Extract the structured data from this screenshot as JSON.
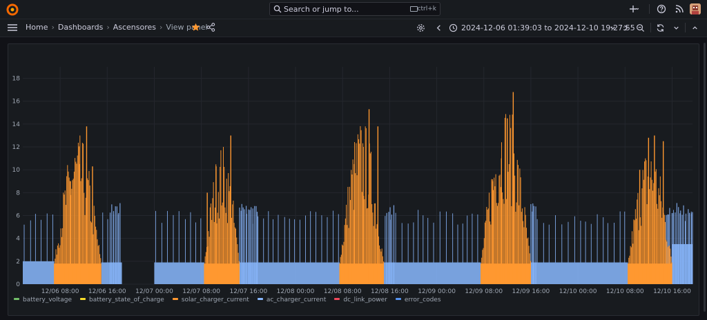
{
  "topbar": {
    "search_placeholder": "Search or jump to...",
    "search_shortcut": "ctrl+k"
  },
  "breadcrumb": {
    "items": [
      "Home",
      "Dashboards",
      "Ascensores"
    ],
    "current": "View panel"
  },
  "time_range": {
    "label": "2024-12-06 01:39:03 to 2024-12-10 19:27:55"
  },
  "colors": {
    "background": "#111217",
    "panel": "#181b1f",
    "brand_orange": "#f46800",
    "star": "#ff9830"
  },
  "chart_data": {
    "type": "area",
    "ylim": [
      0,
      19
    ],
    "xlim": [
      "2024-12-06 01:39",
      "2024-12-10 19:28"
    ],
    "y_ticks": [
      "0",
      "2",
      "4",
      "6",
      "8",
      "10",
      "12",
      "14",
      "16",
      "18"
    ],
    "x_ticks": [
      "12/06 08:00",
      "12/06 16:00",
      "12/07 00:00",
      "12/07 08:00",
      "12/07 16:00",
      "12/08 00:00",
      "12/08 08:00",
      "12/08 16:00",
      "12/09 00:00",
      "12/09 08:00",
      "12/09 16:00",
      "12/10 00:00",
      "12/10 08:00",
      "12/10 16:00"
    ],
    "grid": true,
    "legend_position": "bottom",
    "series": [
      {
        "name": "battery_voltage",
        "color": "#73bf69"
      },
      {
        "name": "battery_state_of_charge",
        "color": "#fade2a"
      },
      {
        "name": "solar_charger_current",
        "color": "#ff9830",
        "peaks": [
          {
            "x": "2024-12-06 09:45",
            "y": 9.0
          },
          {
            "x": "2024-12-06 11:15",
            "y": 10.5
          },
          {
            "x": "2024-12-06 12:30",
            "y": 13.8
          },
          {
            "x": "2024-12-06 13:30",
            "y": 10.3
          },
          {
            "x": "2024-12-07 09:00",
            "y": 8.0
          },
          {
            "x": "2024-12-07 10:30",
            "y": 10.3
          },
          {
            "x": "2024-12-07 13:00",
            "y": 13.0
          },
          {
            "x": "2024-12-08 10:00",
            "y": 10.5
          },
          {
            "x": "2024-12-08 11:30",
            "y": 12.0
          },
          {
            "x": "2024-12-08 12:30",
            "y": 15.3
          },
          {
            "x": "2024-12-08 14:00",
            "y": 13.8
          },
          {
            "x": "2024-12-09 09:30",
            "y": 9.0
          },
          {
            "x": "2024-12-09 11:00",
            "y": 11.0
          },
          {
            "x": "2024-12-09 12:00",
            "y": 14.5
          },
          {
            "x": "2024-12-09 13:00",
            "y": 16.8
          },
          {
            "x": "2024-12-10 10:30",
            "y": 10.0
          },
          {
            "x": "2024-12-10 12:00",
            "y": 12.8
          },
          {
            "x": "2024-12-10 13:00",
            "y": 13.0
          },
          {
            "x": "2024-12-10 14:30",
            "y": 12.5
          }
        ]
      },
      {
        "name": "ac_charger_current",
        "color": "#8ab8ff",
        "baseline": 1.9,
        "segments": [
          {
            "start": "2024-12-06 01:39",
            "end": "2024-12-06 07:00",
            "level": 2.0
          },
          {
            "start": "2024-12-06 15:00",
            "end": "2024-12-06 18:30",
            "level": 1.9
          },
          {
            "start": "2024-12-07 00:00",
            "end": "2024-12-07 08:30",
            "level": 1.9
          },
          {
            "start": "2024-12-07 14:30",
            "end": "2024-12-08 07:30",
            "level": 1.9
          },
          {
            "start": "2024-12-08 15:00",
            "end": "2024-12-09 07:30",
            "level": 1.9
          },
          {
            "start": "2024-12-09 16:00",
            "end": "2024-12-10 08:30",
            "level": 1.9
          },
          {
            "start": "2024-12-10 16:00",
            "end": "2024-12-10 19:28",
            "level": 3.5
          }
        ]
      },
      {
        "name": "dc_link_power",
        "color": "#f2495c"
      },
      {
        "name": "error_codes",
        "color": "#5794f2"
      }
    ]
  }
}
